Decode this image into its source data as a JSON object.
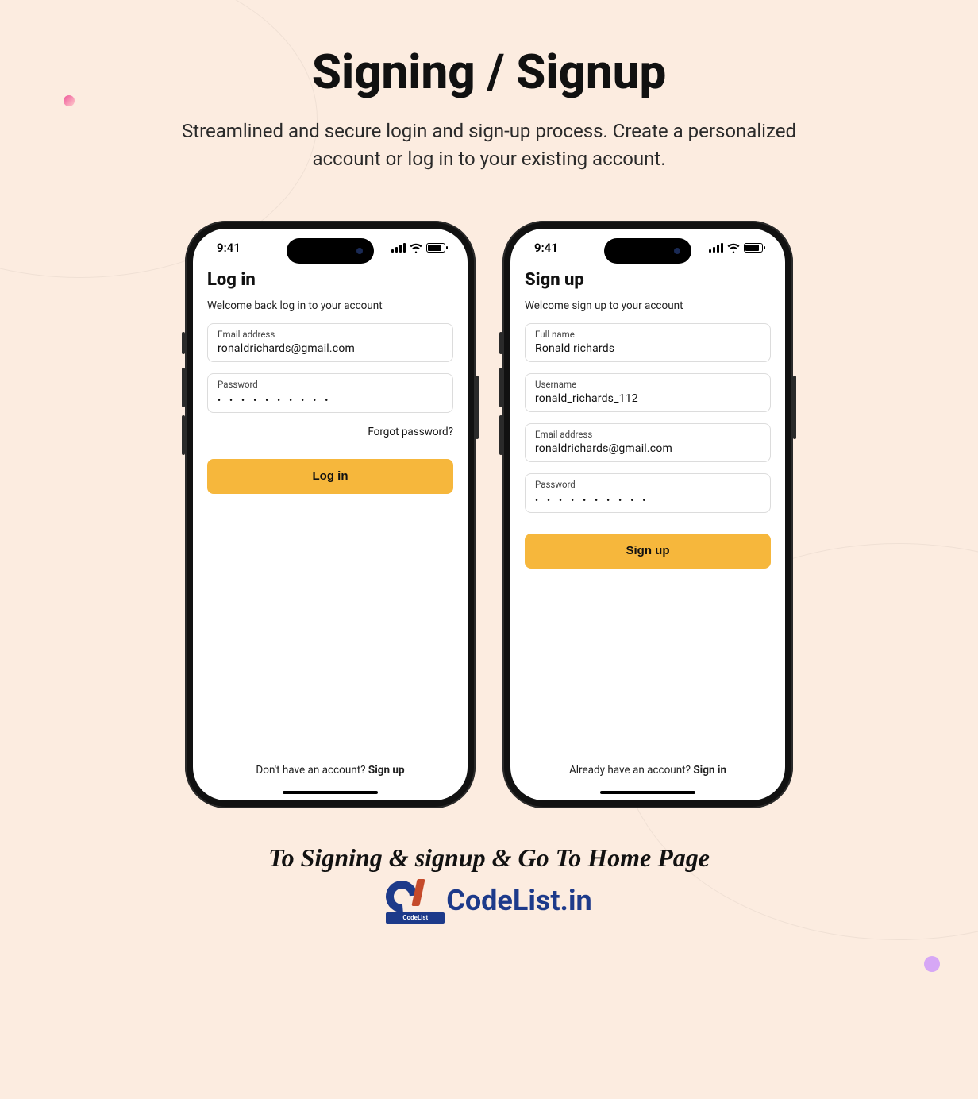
{
  "header": {
    "title": "Signing / Signup",
    "subtitle": "Streamlined and secure login and sign-up process. Create a personalized account or log in to your existing account."
  },
  "status": {
    "time": "9:41"
  },
  "login": {
    "title": "Log in",
    "subtitle": "Welcome back log in to your account",
    "email_label": "Email address",
    "email_value": "ronaldrichards@gmail.com",
    "password_label": "Password",
    "password_dots": "• • • • • • • • • •",
    "forgot": "Forgot password?",
    "button": "Log in",
    "footer_text": "Don't have an account? ",
    "footer_action": "Sign up"
  },
  "signup": {
    "title": "Sign up",
    "subtitle": "Welcome sign up to your account",
    "fullname_label": "Full name",
    "fullname_value": "Ronald richards",
    "username_label": "Username",
    "username_value": "ronald_richards_112",
    "email_label": "Email address",
    "email_value": "ronaldrichards@gmail.com",
    "password_label": "Password",
    "password_dots": "• • • • • • • • • •",
    "button": "Sign up",
    "footer_text": "Already have an account? ",
    "footer_action": "Sign in"
  },
  "tagline": "To Signing & signup & Go To Home Page",
  "brand": {
    "name": "CodeList.in",
    "logo_caption": "CodeList"
  }
}
